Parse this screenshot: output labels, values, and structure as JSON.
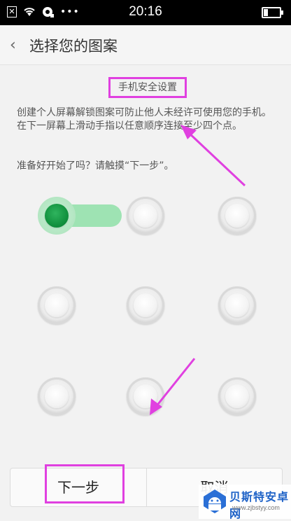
{
  "status_bar": {
    "time": "20:16",
    "left_icons": [
      "sim-x-icon",
      "wifi-icon",
      "notification-icon",
      "more-dots-icon"
    ],
    "dots": "•••",
    "x_glyph": "✕",
    "right_icons": [
      "battery-icon"
    ]
  },
  "header": {
    "back_icon": "chevron-left-icon",
    "back_glyph": "‹",
    "title": "选择您的图案"
  },
  "content": {
    "subtitle": "手机安全设置",
    "description": "创建个人屏幕解锁图案可防止他人未经许可使用您的手机。在下一屏幕上滑动手指以任意顺序连接至少四个点。",
    "hint": "准备好开始了吗？请触摸“下一步”。"
  },
  "pattern": {
    "rows": 3,
    "cols": 3,
    "active_dot": 0,
    "active_color": "#12923f",
    "track_color": "#8fe0a8"
  },
  "footer": {
    "next_label": "下一步",
    "cancel_label": "取消"
  },
  "annotation_color": "#e040e0",
  "watermark": {
    "name": "贝斯特安卓网",
    "url": "www.zjbstyy.com"
  }
}
